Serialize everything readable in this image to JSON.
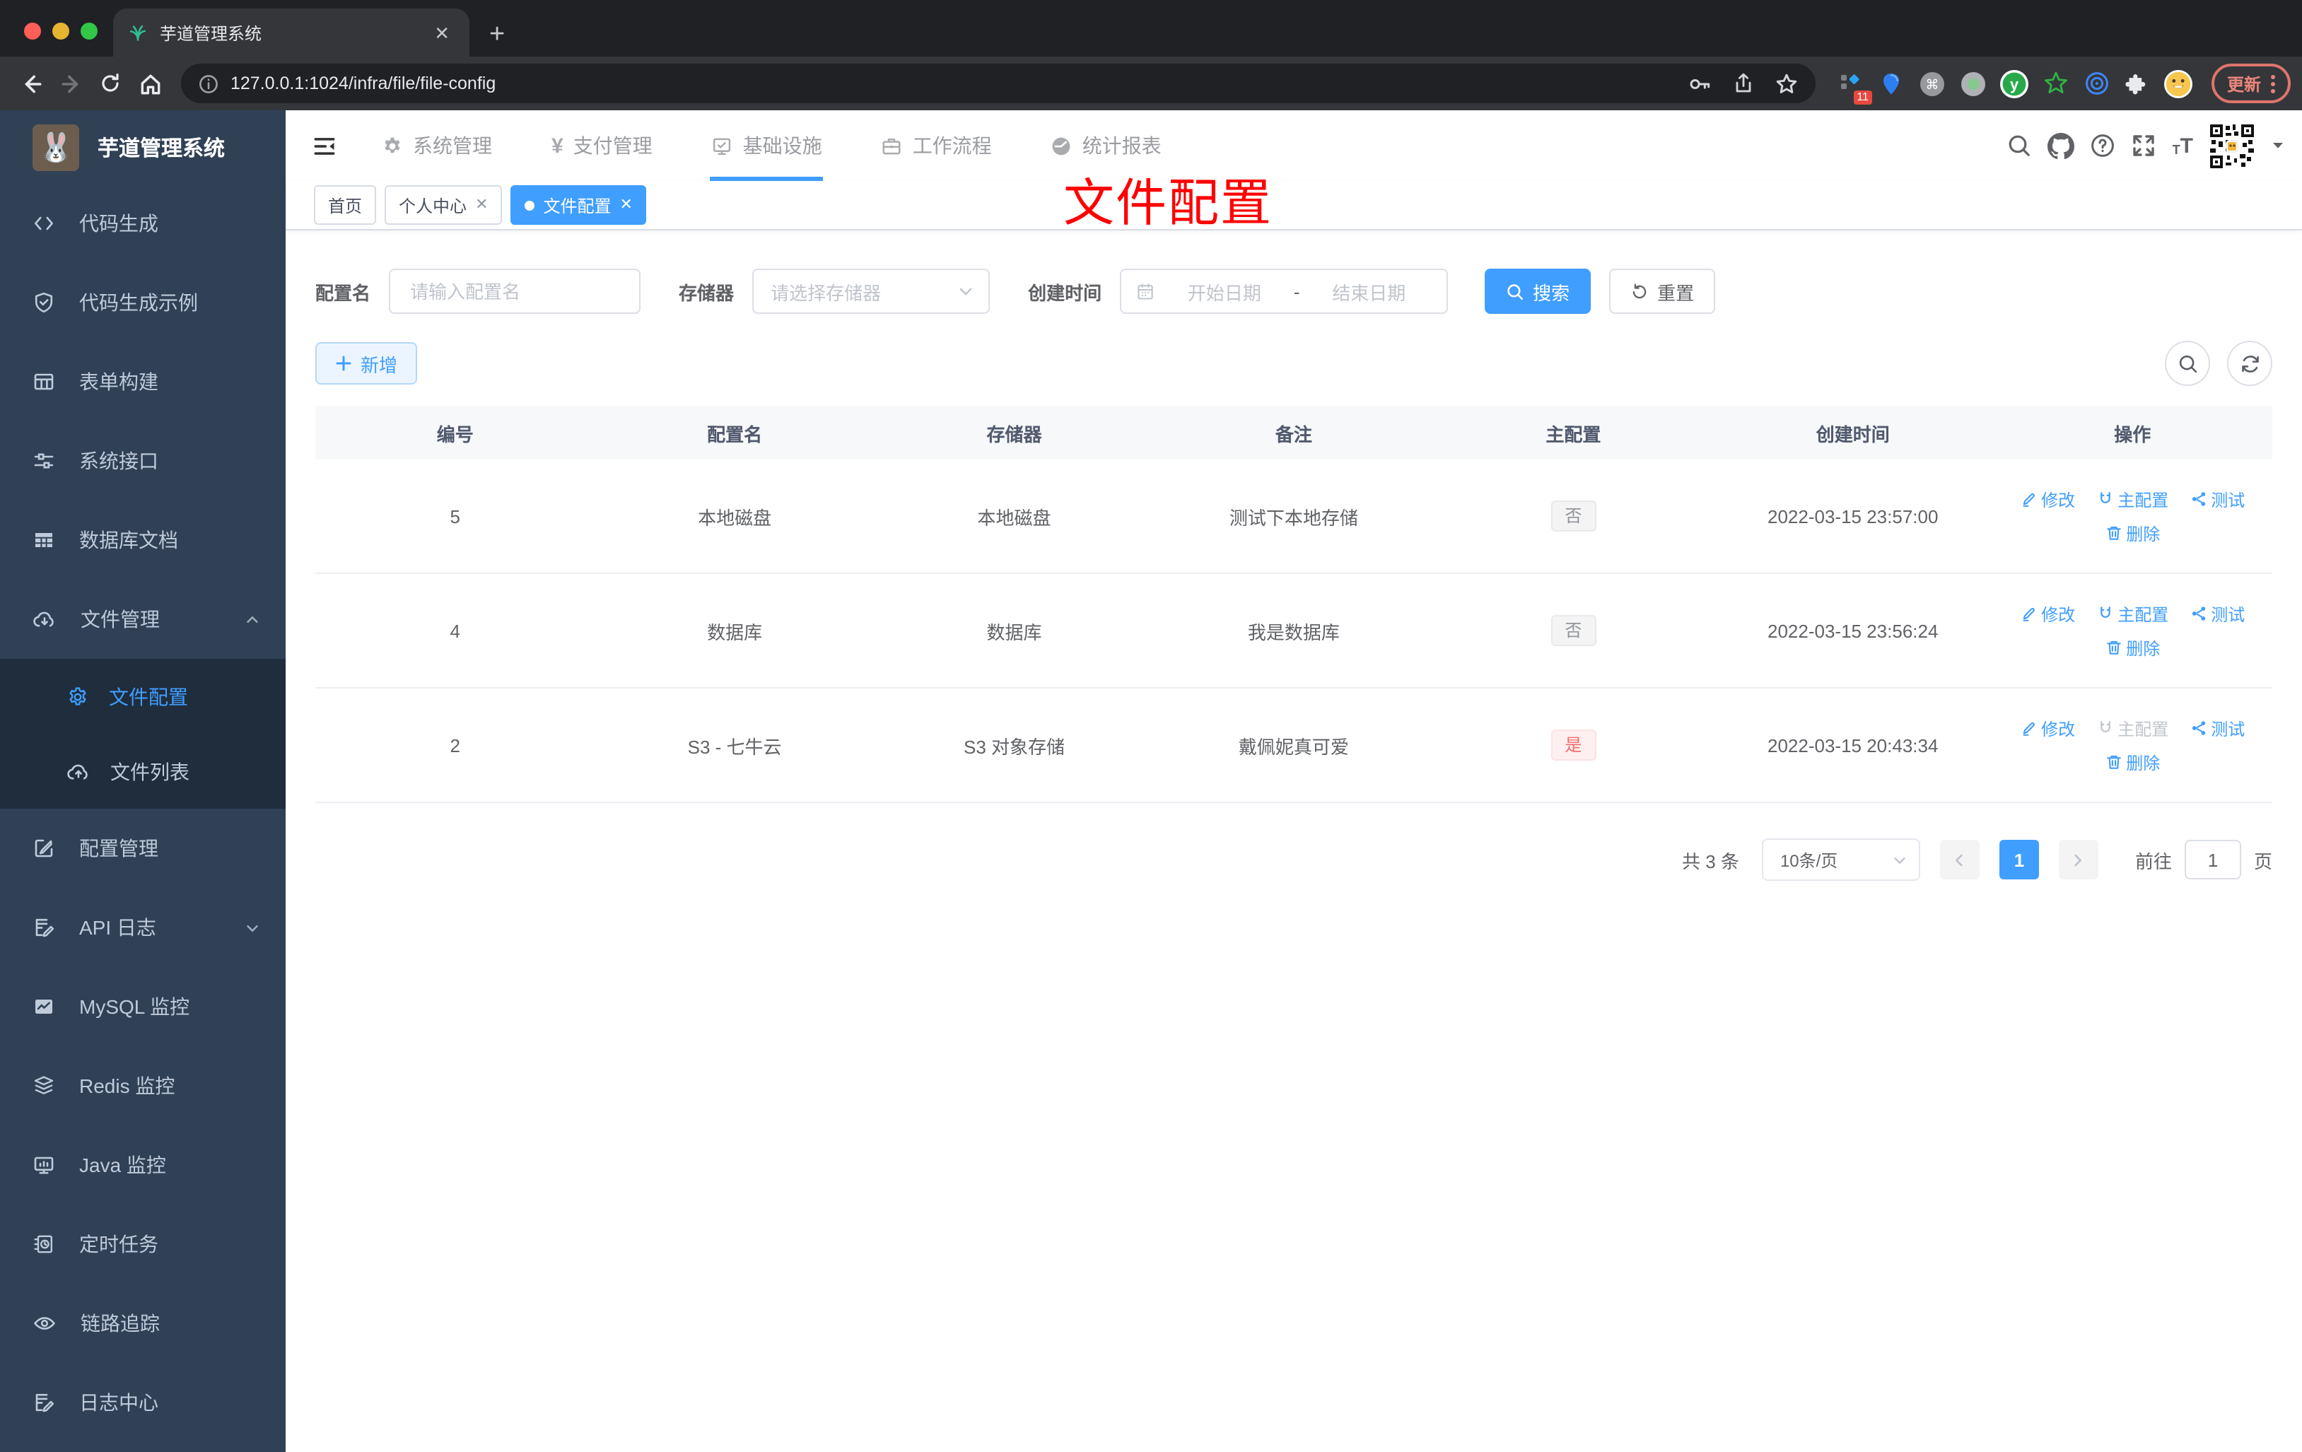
{
  "browser": {
    "tab_title": "芋道管理系统",
    "url": "127.0.0.1:1024/infra/file/file-config",
    "update_label": "更新",
    "ext_badge": "11"
  },
  "app": {
    "title": "芋道管理系统"
  },
  "sidebar": {
    "items": [
      {
        "label": "代码生成",
        "icon": "code-icon"
      },
      {
        "label": "代码生成示例",
        "icon": "shield-check-icon"
      },
      {
        "label": "表单构建",
        "icon": "form-grid-icon"
      },
      {
        "label": "系统接口",
        "icon": "sliders-icon"
      },
      {
        "label": "数据库文档",
        "icon": "database-table-icon"
      },
      {
        "label": "文件管理",
        "icon": "cloud-download-icon",
        "expanded": true
      },
      {
        "label": "文件配置",
        "icon": "gear-icon",
        "active": true,
        "child": true
      },
      {
        "label": "文件列表",
        "icon": "cloud-upload-icon",
        "child": true
      },
      {
        "label": "配置管理",
        "icon": "edit-square-icon"
      },
      {
        "label": "API 日志",
        "icon": "log-edit-icon",
        "collapsed": true
      },
      {
        "label": "MySQL 监控",
        "icon": "chart-monitor-icon"
      },
      {
        "label": "Redis 监控",
        "icon": "layers-icon"
      },
      {
        "label": "Java 监控",
        "icon": "monitor-icon"
      },
      {
        "label": "定时任务",
        "icon": "schedule-icon"
      },
      {
        "label": "链路追踪",
        "icon": "eye-icon"
      },
      {
        "label": "日志中心",
        "icon": "log-center-icon"
      }
    ]
  },
  "topnav": {
    "items": [
      {
        "label": "系统管理",
        "icon": "gear-icon"
      },
      {
        "label": "支付管理",
        "icon": "yen-icon"
      },
      {
        "label": "基础设施",
        "icon": "infra-monitor-icon",
        "active": true
      },
      {
        "label": "工作流程",
        "icon": "briefcase-icon"
      },
      {
        "label": "统计报表",
        "icon": "stats-gauge-icon"
      }
    ]
  },
  "tags": {
    "tabs": [
      {
        "label": "首页"
      },
      {
        "label": "个人中心",
        "closable": true
      },
      {
        "label": "文件配置",
        "closable": true,
        "active": true
      }
    ]
  },
  "overlay_title": "文件配置",
  "filter": {
    "name_label": "配置名",
    "name_placeholder": "请输入配置名",
    "storage_label": "存储器",
    "storage_placeholder": "请选择存储器",
    "time_label": "创建时间",
    "start_placeholder": "开始日期",
    "separator": "-",
    "end_placeholder": "结束日期",
    "search_label": "搜索",
    "reset_label": "重置"
  },
  "toolbar": {
    "add_label": "新增"
  },
  "table": {
    "headers": [
      "编号",
      "配置名",
      "存储器",
      "备注",
      "主配置",
      "创建时间",
      "操作"
    ],
    "action_labels": {
      "edit": "修改",
      "master": "主配置",
      "test": "测试",
      "del": "删除"
    },
    "rows": [
      {
        "id": "5",
        "name": "本地磁盘",
        "storage": "本地磁盘",
        "remark": "测试下本地存储",
        "master": "否",
        "created": "2022-03-15 23:57:00"
      },
      {
        "id": "4",
        "name": "数据库",
        "storage": "数据库",
        "remark": "我是数据库",
        "master": "否",
        "created": "2022-03-15 23:56:24"
      },
      {
        "id": "2",
        "name": "S3 - 七牛云",
        "storage": "S3 对象存储",
        "remark": "戴佩妮真可爱",
        "master": "是",
        "created": "2022-03-15 20:43:34"
      }
    ]
  },
  "pagination": {
    "total": "共 3 条",
    "page_size": "10条/页",
    "page": "1",
    "goto_label": "前往",
    "goto_value": "1",
    "unit_label": "页"
  },
  "colors": {
    "accent": "#409eff",
    "danger": "#f56c6c",
    "sidebar_bg": "#304156",
    "submenu_bg": "#1f2d3d"
  }
}
